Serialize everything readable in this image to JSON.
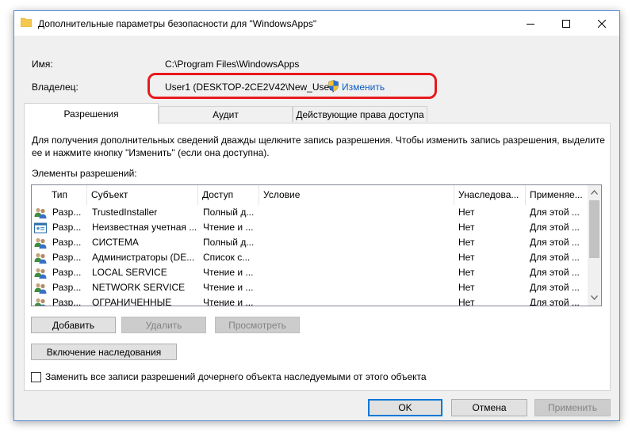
{
  "window": {
    "title": "Дополнительные параметры безопасности  для \"WindowsApps\""
  },
  "info": {
    "name_label": "Имя:",
    "name_value": "C:\\Program Files\\WindowsApps",
    "owner_label": "Владелец:",
    "owner_value": "User1 (DESKTOP-2CE2V42\\New_User)",
    "change_link": "Изменить"
  },
  "tabs": [
    {
      "label": "Разрешения",
      "active": true
    },
    {
      "label": "Аудит",
      "active": false
    },
    {
      "label": "Действующие права доступа",
      "active": false
    }
  ],
  "panel": {
    "description_line1": "Для получения дополнительных сведений дважды щелкните запись разрешения. Чтобы изменить запись разрешения, выделите",
    "description_line2": "ее и нажмите кнопку \"Изменить\" (если она доступна).",
    "list_label": "Элементы разрешений:"
  },
  "table": {
    "columns": [
      "Тип",
      "Субъект",
      "Доступ",
      "Условие",
      "Унаследова...",
      "Применяе..."
    ],
    "rows": [
      {
        "icon": "users-icon",
        "type": "Разр...",
        "subject": "TrustedInstaller",
        "access": "Полный д...",
        "condition": "",
        "inherited": "Нет",
        "applies": "Для этой ..."
      },
      {
        "icon": "unknown-account-icon",
        "type": "Разр...",
        "subject": "Неизвестная учетная ...",
        "access": "Чтение и ...",
        "condition": "",
        "inherited": "Нет",
        "applies": "Для этой ..."
      },
      {
        "icon": "users-icon",
        "type": "Разр...",
        "subject": "СИСТЕМА",
        "access": "Полный д...",
        "condition": "",
        "inherited": "Нет",
        "applies": "Для этой ..."
      },
      {
        "icon": "users-icon",
        "type": "Разр...",
        "subject": "Администраторы (DE...",
        "access": "Список с...",
        "condition": "",
        "inherited": "Нет",
        "applies": "Для этой ..."
      },
      {
        "icon": "users-icon",
        "type": "Разр...",
        "subject": "LOCAL SERVICE",
        "access": "Чтение и ...",
        "condition": "",
        "inherited": "Нет",
        "applies": "Для этой ..."
      },
      {
        "icon": "users-icon",
        "type": "Разр...",
        "subject": "NETWORK SERVICE",
        "access": "Чтение и ...",
        "condition": "",
        "inherited": "Нет",
        "applies": "Для этой ..."
      },
      {
        "icon": "users-icon",
        "type": "Разр...",
        "subject": "ОГРАНИЧЕННЫЕ",
        "access": "Чтение и ...",
        "condition": "",
        "inherited": "Нет",
        "applies": "Для этой ..."
      }
    ]
  },
  "buttons": {
    "add": "Добавить",
    "remove": "Удалить",
    "view": "Просмотреть",
    "enable_inheritance": "Включение наследования",
    "ok": "OK",
    "cancel": "Отмена",
    "apply": "Применить"
  },
  "checkbox": {
    "label": "Заменить все записи разрешений дочернего объекта наследуемыми от этого объекта",
    "checked": false
  },
  "colors": {
    "highlight": "#e8191c",
    "link": "#0b5cc1",
    "accent": "#0078d7"
  }
}
